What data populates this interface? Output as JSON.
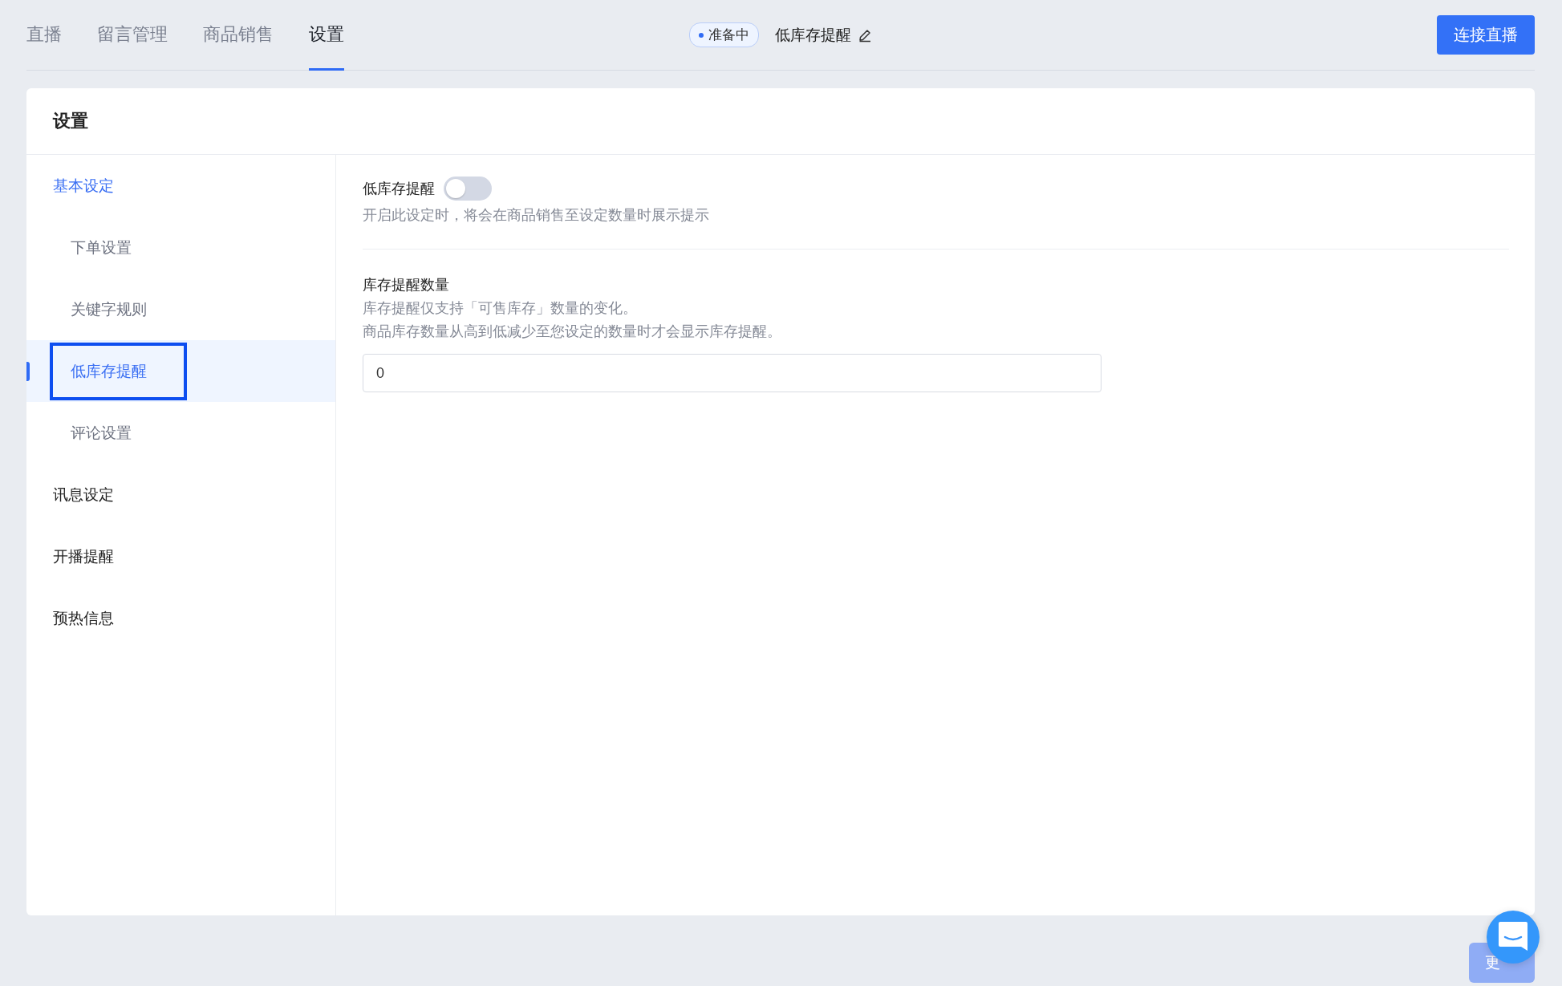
{
  "tabs": [
    {
      "label": "直播",
      "selected": false
    },
    {
      "label": "留言管理",
      "selected": false
    },
    {
      "label": "商品销售",
      "selected": false
    },
    {
      "label": "设置",
      "selected": true
    }
  ],
  "status_badge": "准备中",
  "page_title": "低库存提醒",
  "connect_button": "连接直播",
  "card": {
    "title": "设置"
  },
  "sidebar": {
    "items": [
      {
        "label": "基本设定",
        "children": [
          {
            "label": "下单设置",
            "selected": false
          },
          {
            "label": "关键字规则",
            "selected": false
          },
          {
            "label": "低库存提醒",
            "selected": true
          },
          {
            "label": "评论设置",
            "selected": false
          }
        ]
      },
      {
        "label": "讯息设定",
        "selected": false
      },
      {
        "label": "开播提醒",
        "selected": false
      },
      {
        "label": "预热信息",
        "selected": false
      }
    ]
  },
  "low_stock_toggle": {
    "label": "低库存提醒",
    "on": false,
    "hint": "开启此设定时，将会在商品销售至设定数量时展示提示"
  },
  "quantity": {
    "label": "库存提醒数量",
    "hints": [
      "库存提醒仅支持「可售库存」数量的变化。",
      "商品库存数量从高到低减少至您设定的数量时才会显示库存提醒。"
    ],
    "value": "0"
  },
  "update_button": "更"
}
